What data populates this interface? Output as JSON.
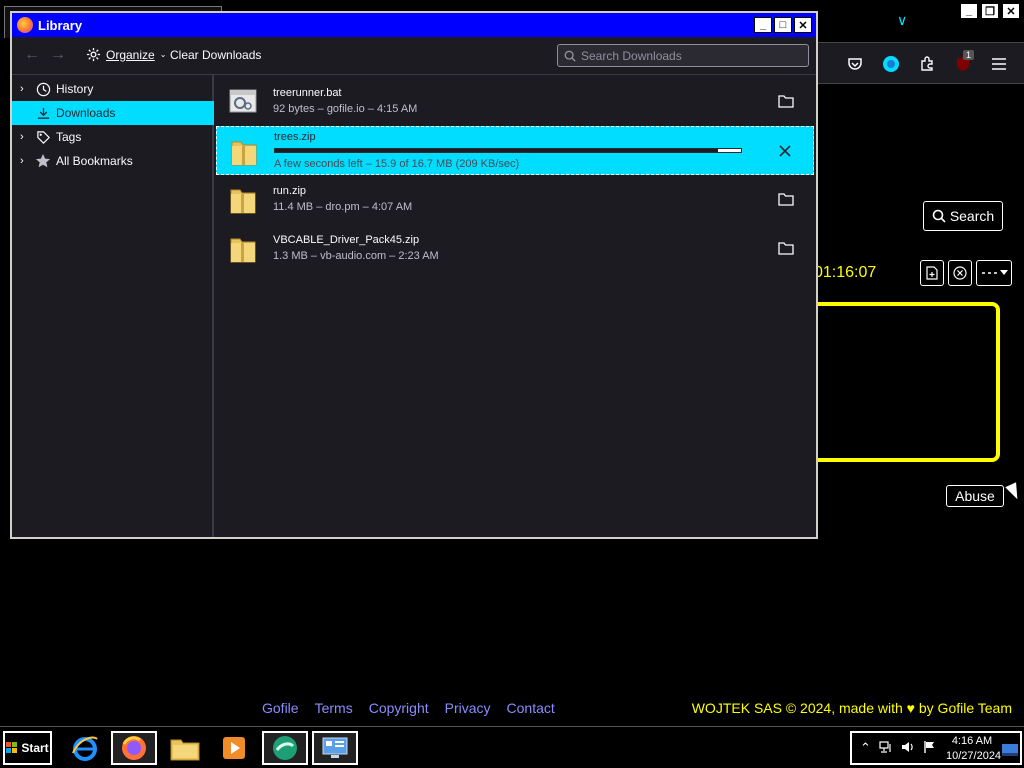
{
  "window": {
    "title": "Library",
    "toolbar": {
      "organize_label": "Organize",
      "clear_label": "Clear Downloads",
      "search_placeholder": "Search Downloads"
    },
    "sidebar": [
      {
        "label": "History",
        "icon": "clock-icon",
        "selected": false
      },
      {
        "label": "Downloads",
        "icon": "download-icon",
        "selected": true
      },
      {
        "label": "Tags",
        "icon": "tag-icon",
        "selected": false
      },
      {
        "label": "All Bookmarks",
        "icon": "star-icon",
        "selected": false
      }
    ],
    "downloads": [
      {
        "name": "treerunner.bat",
        "meta": "92 bytes – gofile.io – 4:15 AM",
        "icon": "batch-file-icon",
        "action": "folder-icon"
      },
      {
        "name": "trees.zip",
        "meta": "A few seconds left – 15.9 of 16.7 MB (209 KB/sec)",
        "icon": "zip-folder-icon",
        "action": "cancel-icon",
        "progress": 0.95
      },
      {
        "name": "run.zip",
        "meta": "11.4 MB – dro.pm – 4:07 AM",
        "icon": "zip-folder-icon",
        "action": "folder-icon"
      },
      {
        "name": "VBCABLE_Driver_Pack45.zip",
        "meta": "1.3 MB – vb-audio.com – 2:23 AM",
        "icon": "zip-folder-icon",
        "action": "folder-icon"
      }
    ]
  },
  "background_page": {
    "search_label": "Search",
    "timestamp": "01:16:07",
    "abuse_label": "Abuse",
    "extension_badge": "1",
    "footer_links": [
      "Gofile",
      "Terms",
      "Copyright",
      "Privacy",
      "Contact"
    ],
    "footer_credit_pre": "WOJTEK SAS © 2024, made with",
    "footer_credit_post": "by Gofile Team"
  },
  "taskbar": {
    "start_label": "Start",
    "clock_time": "4:16 AM",
    "clock_date": "10/27/2024"
  },
  "colors": {
    "accent": "#00ddff",
    "title_bar": "#0000ff",
    "highlight": "#ffff00",
    "link": "#8c8cff"
  }
}
